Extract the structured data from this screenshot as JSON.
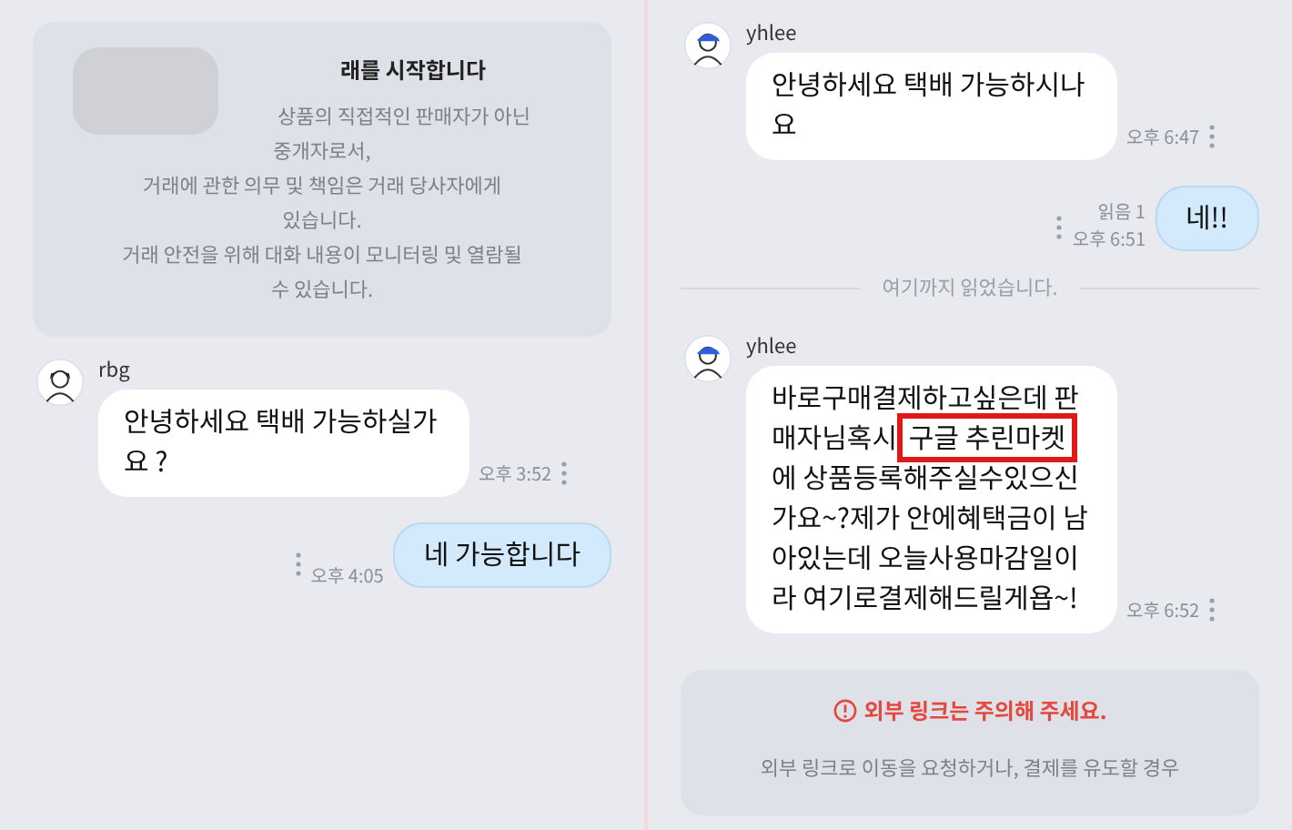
{
  "panels": [
    {
      "items": [
        {
          "kind": "notice",
          "blurred": true,
          "title": "래를 시작합니다",
          "lines": [
            "상품의 직접적인 판매자가 아닌",
            "중개자로서,",
            "거래에 관한 의무 및 책임은 거래 당사자에게",
            "있습니다.",
            "거래 안전을 위해 대화 내용이 모니터링 및 열람될",
            "수 있습니다."
          ]
        },
        {
          "kind": "received",
          "sender": "rbg",
          "segments": [
            {
              "text": "안녕하세요 택배 가능하실가요 ?",
              "boxed": false
            }
          ],
          "time": "오후 3:52"
        },
        {
          "kind": "sent",
          "text": "네 가능합니다",
          "time": "오후 4:05"
        }
      ]
    },
    {
      "items": [
        {
          "kind": "received",
          "sender": "yhlee",
          "segments": [
            {
              "text": "안녕하세요 택배 가능하시나요",
              "boxed": false
            }
          ],
          "time": "오후 6:47"
        },
        {
          "kind": "sent",
          "text": "네!!",
          "read": "읽음 1",
          "time": "오후 6:51"
        },
        {
          "kind": "divider",
          "text": "여기까지 읽었습니다."
        },
        {
          "kind": "received",
          "sender": "yhlee",
          "segments": [
            {
              "text": "바로구매결제하고싶은데 판매자님혹시 ",
              "boxed": false
            },
            {
              "text": "구글 추린마켓",
              "boxed": true
            },
            {
              "text": "에 상품등록해주실수있으신가요~?제가 안에혜택금이 남아있는데 오늘사용마감일이라 여기로결제해드릴게욥~!",
              "boxed": false
            }
          ],
          "time": "오후 6:52"
        },
        {
          "kind": "warning",
          "title": "외부 링크는 주의해 주세요.",
          "lines": [
            "외부 링크로 이동을 요청하거나, 결제를 유도할 경우"
          ]
        }
      ]
    }
  ]
}
